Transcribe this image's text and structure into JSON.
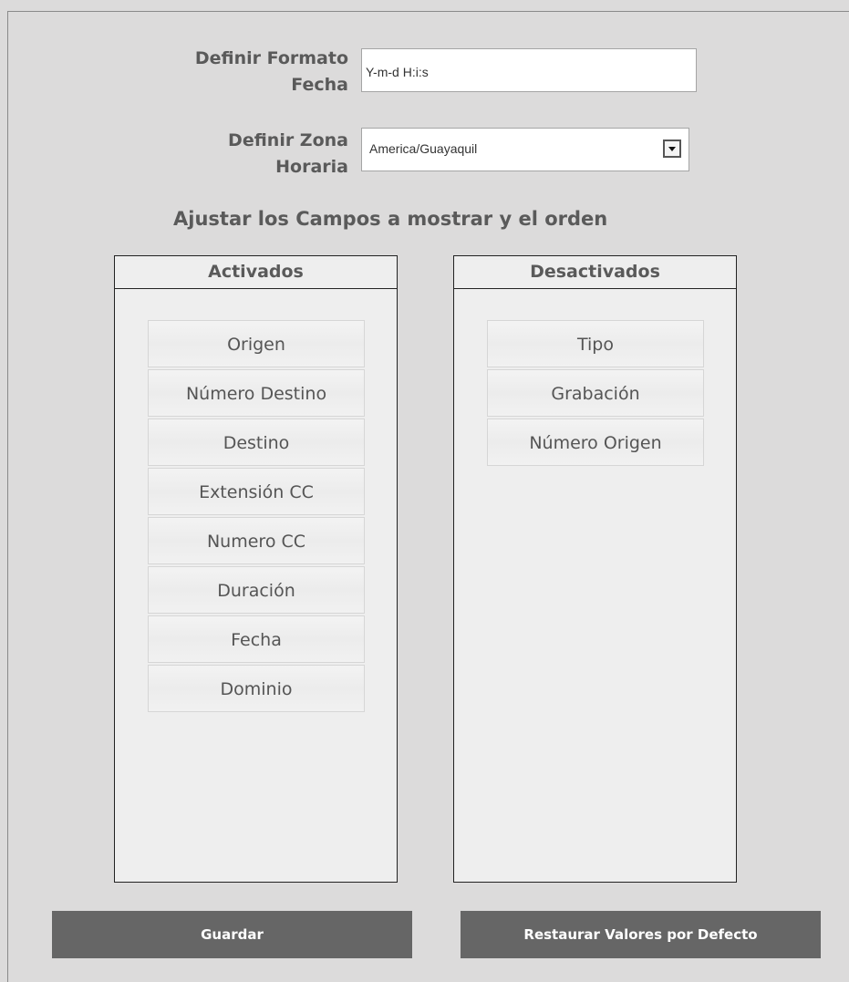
{
  "form": {
    "date_format": {
      "label_line1": "Definir Formato",
      "label_line2": "Fecha",
      "value": "Y-m-d H:i:s"
    },
    "timezone": {
      "label_line1": "Definir Zona",
      "label_line2": "Horaria",
      "selected": "America/Guayaquil"
    }
  },
  "fields_section": {
    "title": "Ajustar los Campos a mostrar y el orden",
    "activated": {
      "header": "Activados",
      "items": [
        "Origen",
        "Número Destino",
        "Destino",
        "Extensión CC",
        "Numero CC",
        "Duración",
        "Fecha",
        "Dominio"
      ]
    },
    "deactivated": {
      "header": "Desactivados",
      "items": [
        "Tipo",
        "Grabación",
        "Número Origen"
      ]
    }
  },
  "actions": {
    "save_label": "Guardar",
    "restore_label": "Restaurar Valores por Defecto"
  }
}
